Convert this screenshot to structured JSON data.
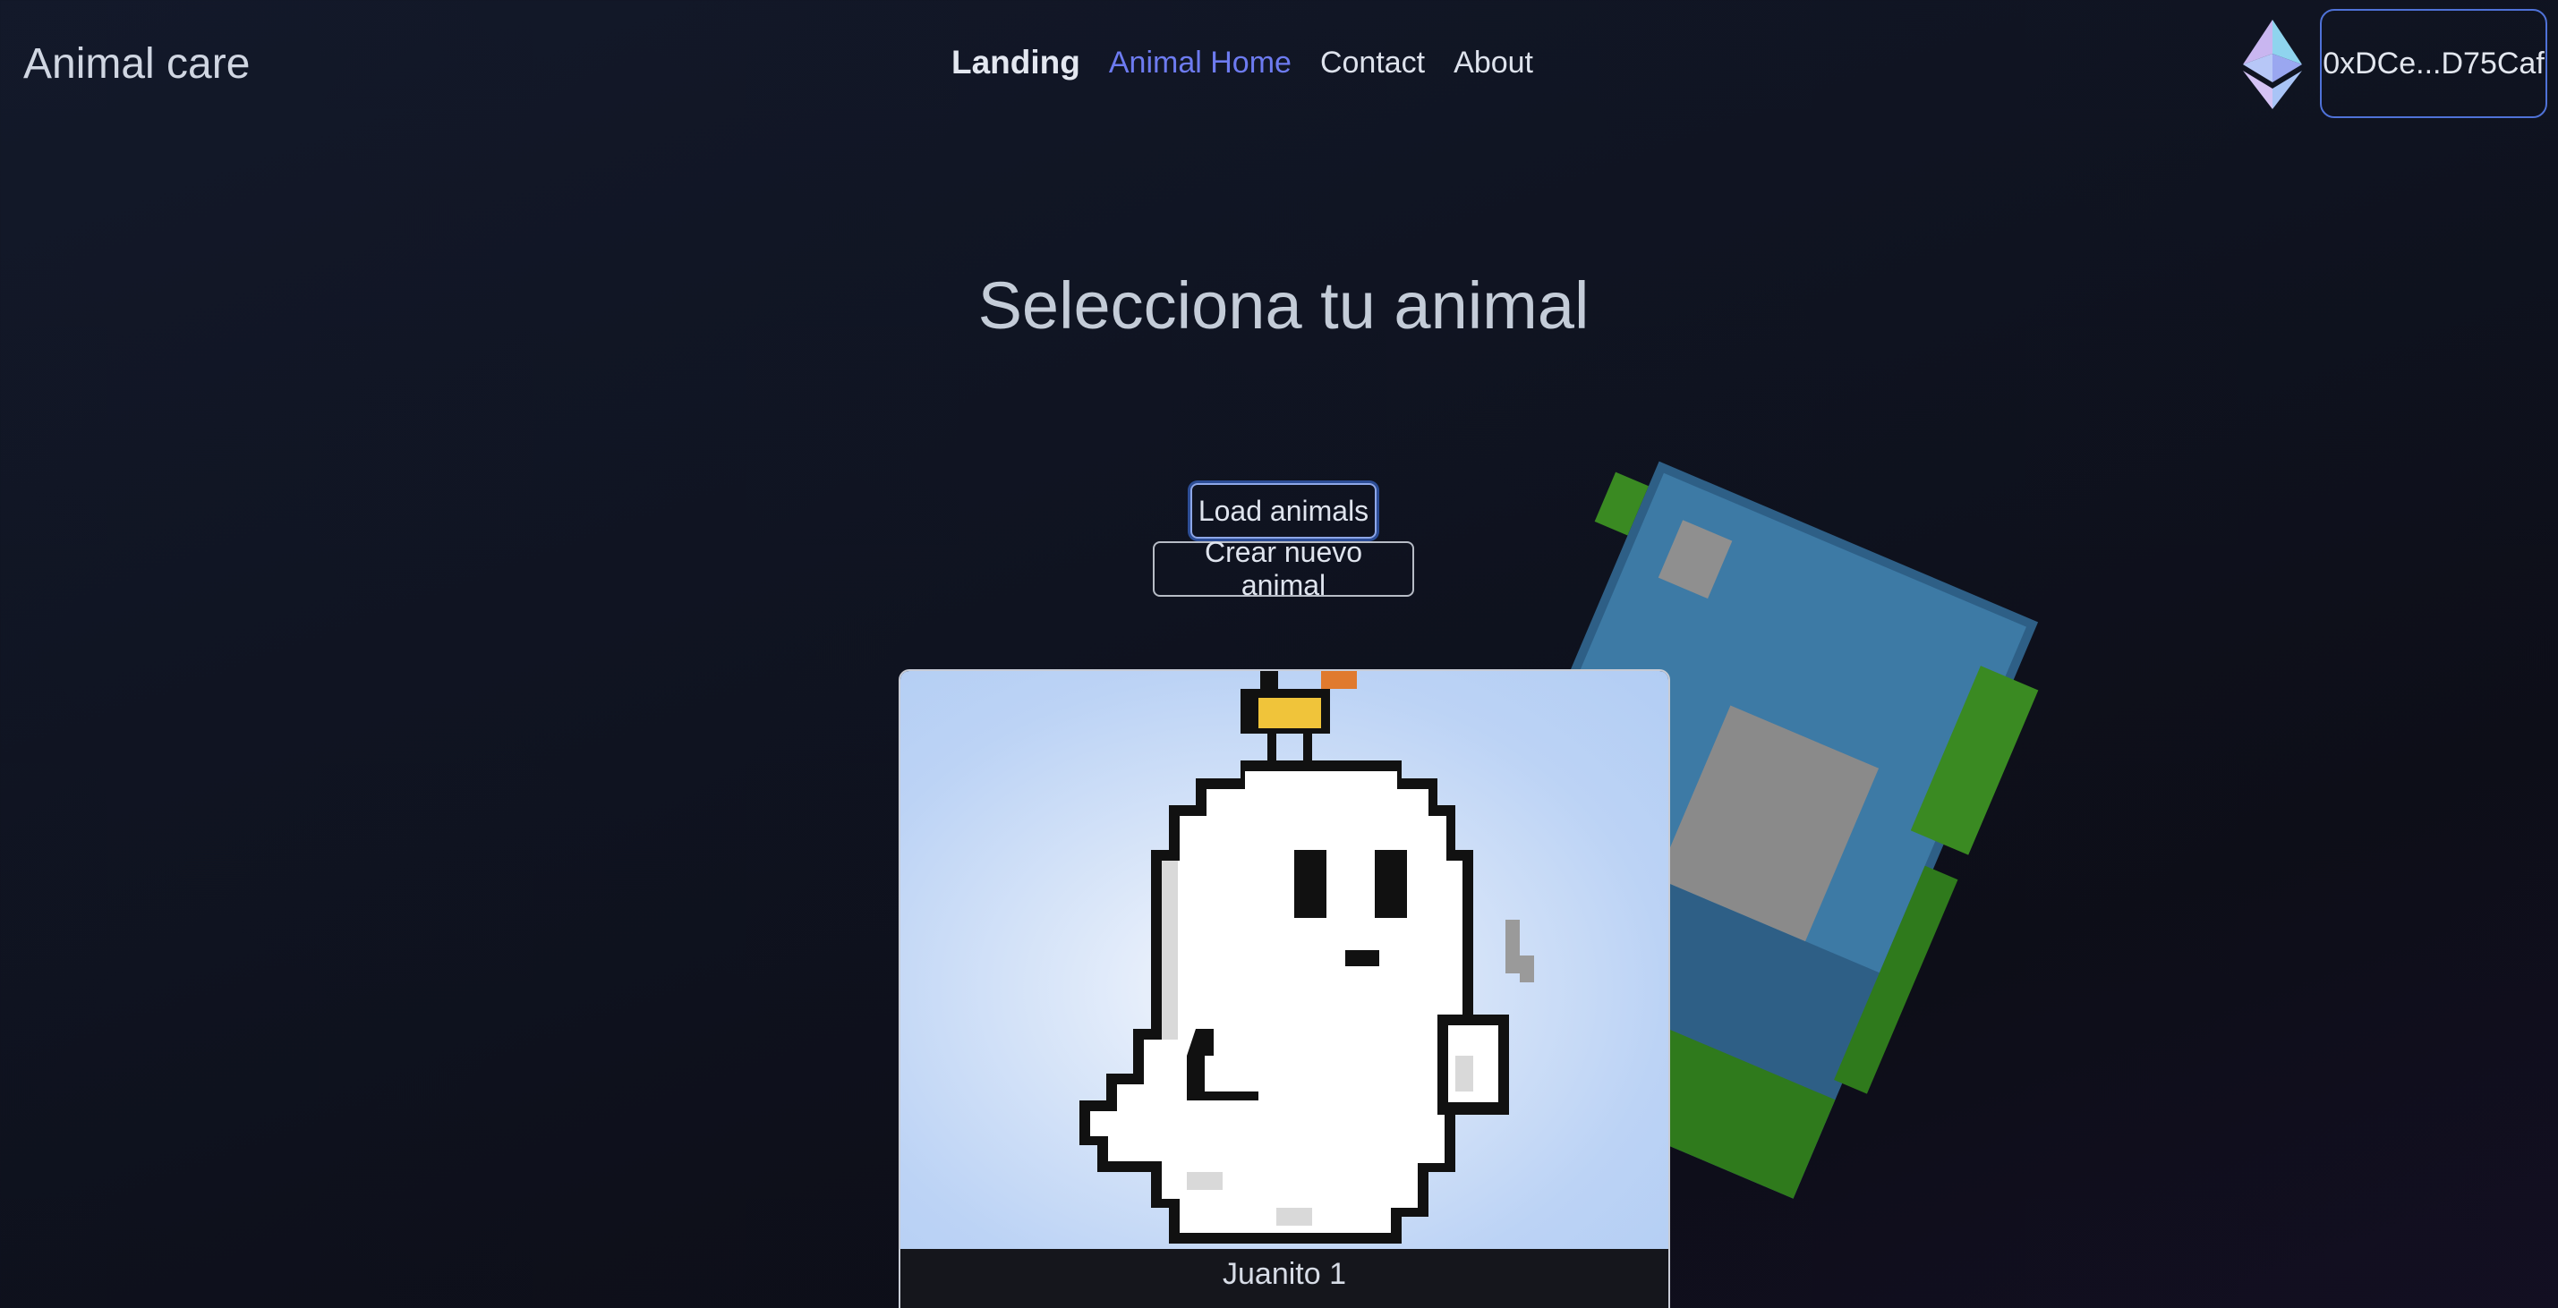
{
  "app": {
    "brand": "Animal care"
  },
  "nav": {
    "items": [
      {
        "label": "Landing"
      },
      {
        "label": "Animal Home"
      },
      {
        "label": "Contact"
      },
      {
        "label": "About"
      }
    ]
  },
  "wallet": {
    "icon": "ethereum-icon",
    "address": "0xDCe...D75Caf",
    "accent": "#4f72d8"
  },
  "main": {
    "title": "Selecciona tu animal",
    "load_button": "Load animals",
    "create_button": "Crear nuevo animal"
  },
  "animals": [
    {
      "name": "Juanito 1",
      "image": "pixel-ghost-with-crown"
    }
  ],
  "colors": {
    "active_nav": "#6d7bf0",
    "card_background": "#b2cdf4"
  }
}
